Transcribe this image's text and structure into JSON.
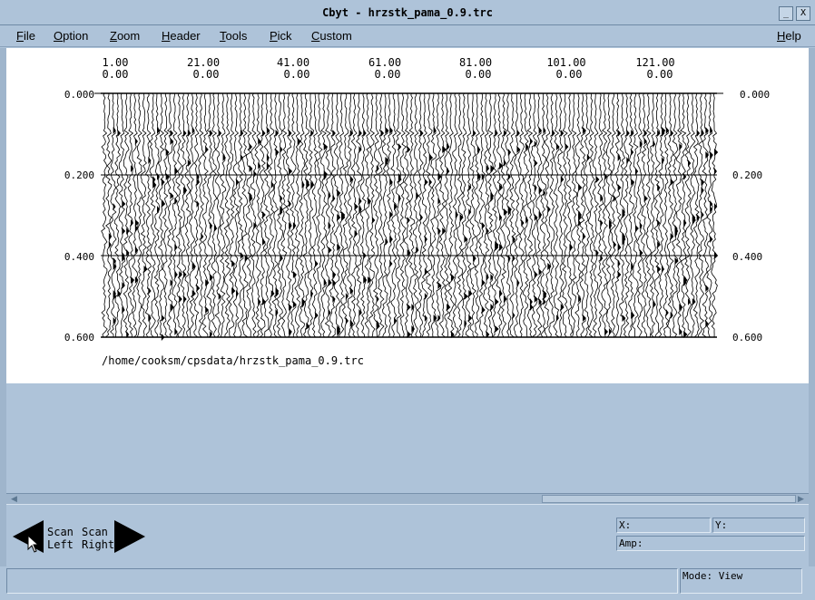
{
  "window": {
    "title": "Cbyt - hrzstk_pama_0.9.trc",
    "minimize_glyph": "_",
    "close_glyph": "X"
  },
  "menu": {
    "items": [
      "File",
      "Option",
      "Zoom",
      "Header",
      "Tools",
      "Pick",
      "Custom"
    ],
    "help": "Help"
  },
  "plot": {
    "trace_labels_top": [
      "1.00",
      "21.00",
      "41.00",
      "61.00",
      "81.00",
      "101.00",
      "121.00"
    ],
    "trace_labels_bottom": [
      "0.00",
      "0.00",
      "0.00",
      "0.00",
      "0.00",
      "0.00",
      "0.00"
    ],
    "time_labels": [
      "0.000",
      "0.200",
      "0.400",
      "0.600"
    ],
    "file_path": "/home/cooksm/cpsdata/hrzstk_pama_0.9.trc",
    "trace_count": 140
  },
  "scan": {
    "left_line1": "Scan",
    "left_line2": "Left",
    "right_line1": "Scan",
    "right_line2": "Right"
  },
  "readout": {
    "x_label": "X:",
    "y_label": "Y:",
    "amp_label": "Amp:"
  },
  "status": {
    "mode": "Mode: View"
  },
  "colors": {
    "chrome": "#aec3d9",
    "plot_bg": "#ffffff",
    "ink": "#000000"
  }
}
